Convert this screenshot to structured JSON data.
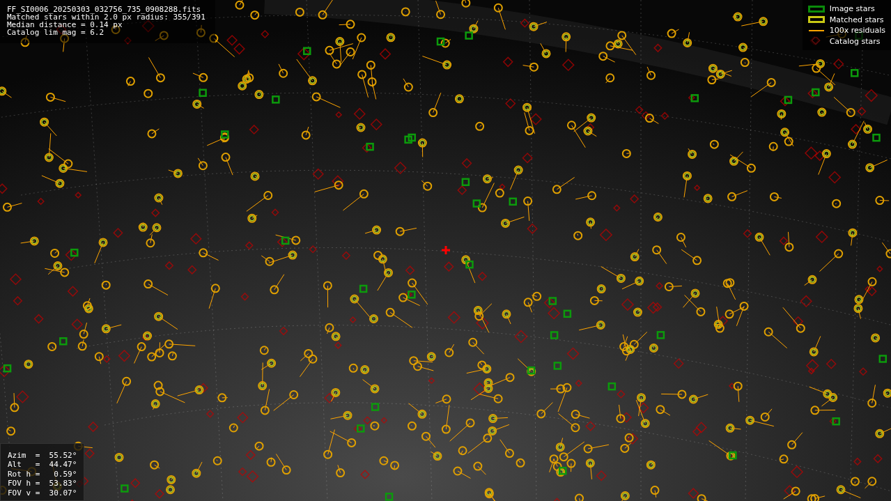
{
  "header": {
    "lines": [
      "FF_SI0006_20250303_032756_735_0908288.fits",
      "Matched stars within 2.0 px radius: 355/391",
      "Median distance = 0.14 px",
      "Catalog lim mag = 6.2"
    ]
  },
  "legend": {
    "items": [
      {
        "label": "Image stars",
        "kind": "box",
        "color": "#0a8a0a"
      },
      {
        "label": "Matched stars",
        "kind": "box",
        "color": "#c8c814"
      },
      {
        "label": "100x residuals",
        "kind": "line",
        "color": "#ffa500"
      },
      {
        "label": "Catalog stars",
        "kind": "diamond",
        "color": "#5a0a0a"
      }
    ]
  },
  "pointing": {
    "lines": [
      "Azim  =  55.52°",
      "Alt   =  44.47°",
      "Rot h =   0.59°",
      "FOV h =  53.83°",
      "FOV v =  30.07°"
    ]
  }
}
